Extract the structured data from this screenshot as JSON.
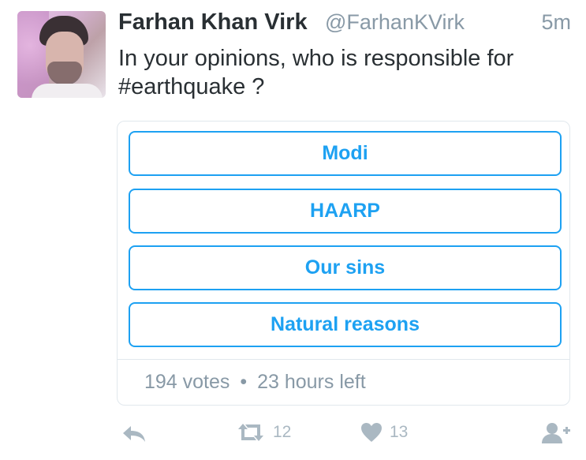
{
  "tweet": {
    "author_name": "Farhan Khan Virk",
    "author_handle": "@FarhanKVirk",
    "timestamp": "5m",
    "text": "In your opinions, who is responsible for #earthquake ?"
  },
  "poll": {
    "options": [
      "Modi",
      "HAARP",
      "Our sins",
      "Natural reasons"
    ],
    "votes": "194 votes",
    "separator": "•",
    "time_left": "23 hours left"
  },
  "actions": {
    "reply_icon": "reply-icon",
    "retweet_icon": "retweet-icon",
    "retweet_count": "12",
    "like_icon": "heart-icon",
    "like_count": "13",
    "follow_icon": "follow-user-icon"
  },
  "colors": {
    "accent": "#1da1f2",
    "text": "#292f33",
    "muted": "#8899a6",
    "icon": "#aab8c2",
    "border": "#e1e8ed"
  }
}
